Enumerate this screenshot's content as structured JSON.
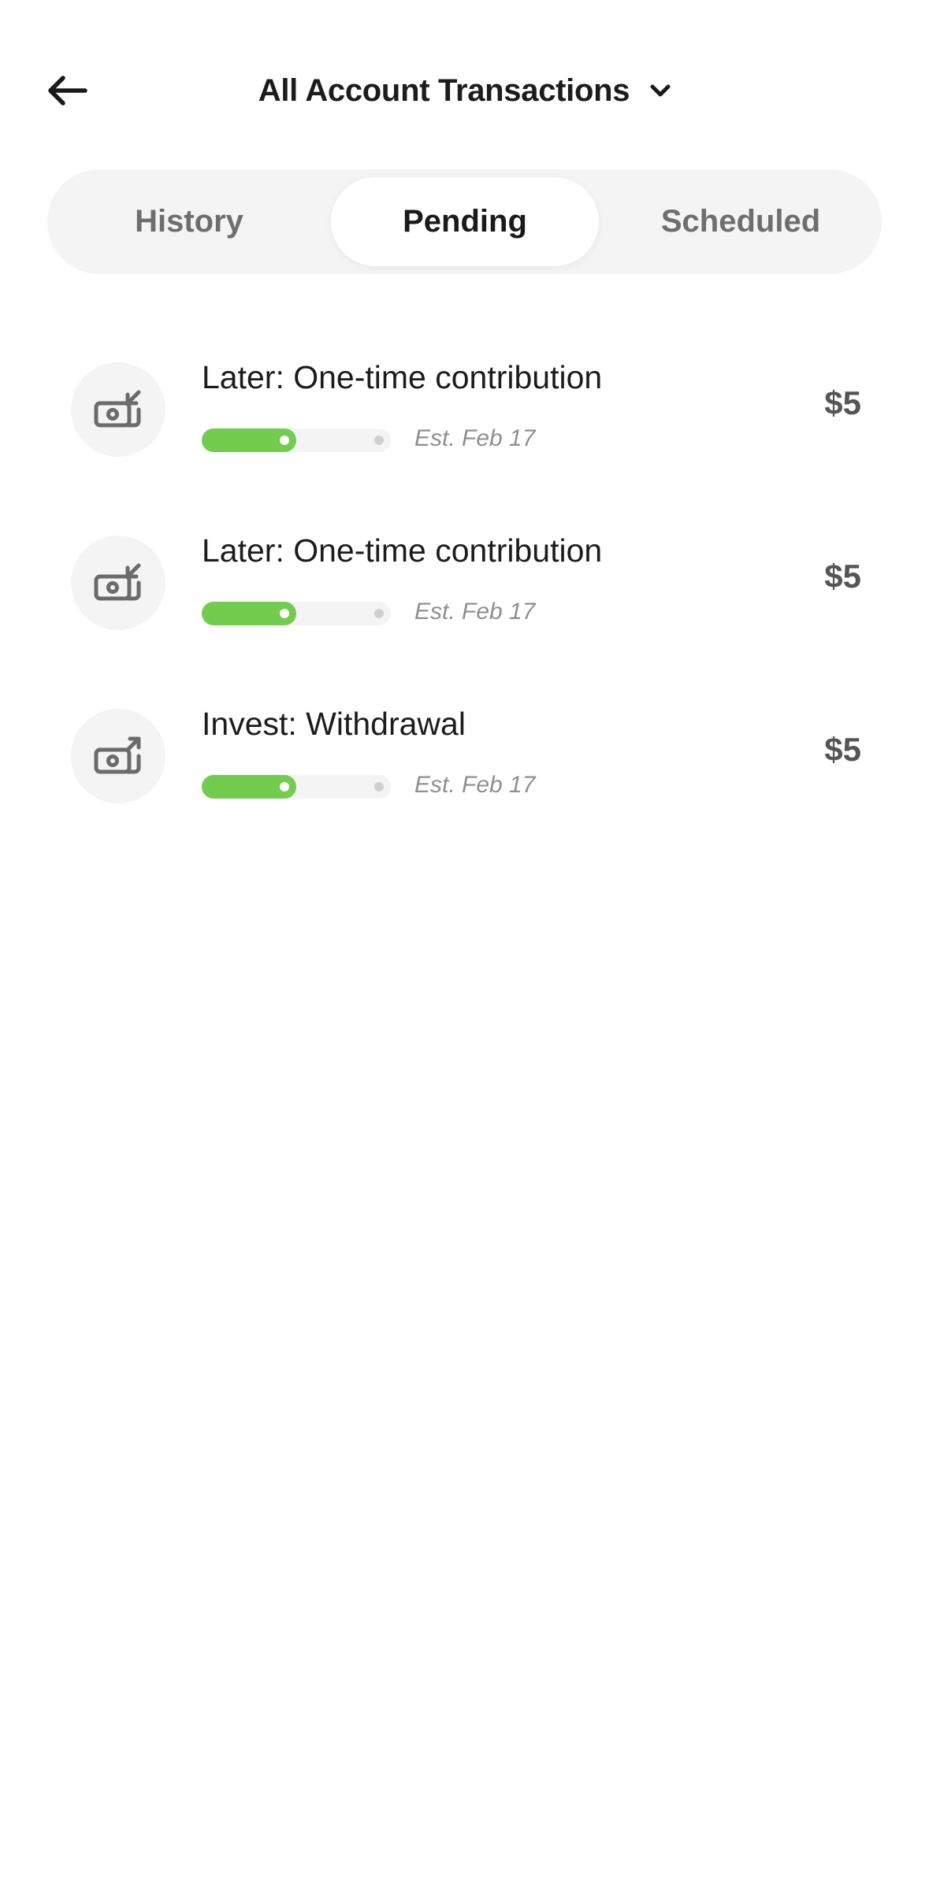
{
  "header": {
    "title": "All Account Transactions",
    "back_icon": "arrow-left-icon",
    "dropdown_icon": "chevron-down-icon"
  },
  "tabs": [
    {
      "label": "History",
      "active": false
    },
    {
      "label": "Pending",
      "active": true
    },
    {
      "label": "Scheduled",
      "active": false
    }
  ],
  "transactions": [
    {
      "title": "Later: One-time contribution",
      "estimate": "Est. Feb 17",
      "amount": "$5",
      "icon": "money-in-icon",
      "progress": 0.5
    },
    {
      "title": "Later: One-time contribution",
      "estimate": "Est. Feb 17",
      "amount": "$5",
      "icon": "money-in-icon",
      "progress": 0.5
    },
    {
      "title": "Invest: Withdrawal",
      "estimate": "Est. Feb 17",
      "amount": "$5",
      "icon": "money-out-icon",
      "progress": 0.5
    }
  ],
  "colors": {
    "accent_green": "#72cc4e",
    "tab_background": "#f4f4f4",
    "icon_gray": "#6b6b6b"
  }
}
